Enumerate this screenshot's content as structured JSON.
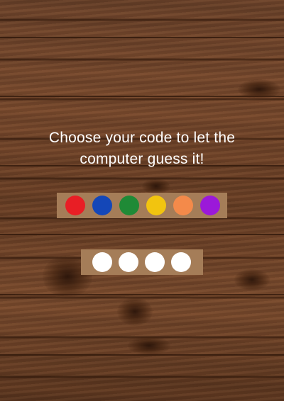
{
  "title": {
    "line1": "Choose your code to let the",
    "line2": "computer guess it!"
  },
  "palette": {
    "colors": [
      "#e81e25",
      "#1447b8",
      "#1f8a36",
      "#f2c40f",
      "#f48a4a",
      "#9b19d9"
    ],
    "names": [
      "red",
      "blue",
      "green",
      "yellow",
      "orange",
      "purple"
    ]
  },
  "code_slots": {
    "count": 4,
    "empty_color": "#ffffff"
  },
  "background": {
    "style": "wood"
  }
}
